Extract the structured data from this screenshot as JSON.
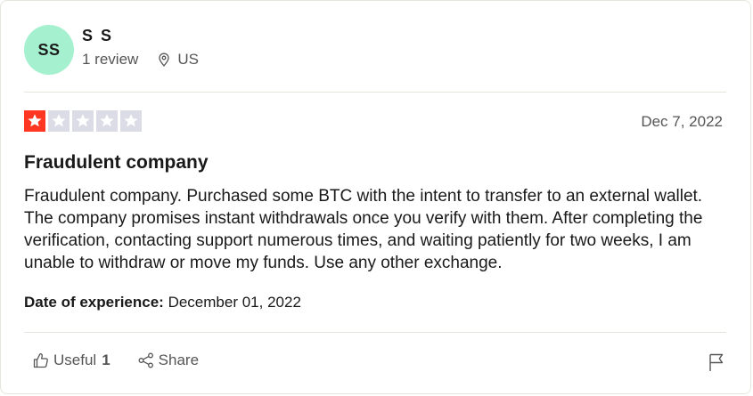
{
  "consumer": {
    "initials": "SS",
    "name": "S S",
    "review_count": "1 review",
    "country": "US",
    "avatar_color": "#a4f0cf"
  },
  "review": {
    "rating": 1,
    "max_rating": 5,
    "star_color_active": "#ff3722",
    "star_color_inactive": "#dcdce6",
    "date": "Dec 7, 2022",
    "title": "Fraudulent company",
    "body": "Fraudulent company. Purchased some BTC with the intent to transfer to an external wallet. The company promises instant withdrawals once you verify with them. After completing the verification, contacting support numerous times, and waiting patiently for two weeks, I am unable to withdraw or move my funds. Use any other exchange.",
    "experience_label": "Date of experience:",
    "experience_date": "December 01, 2022"
  },
  "actions": {
    "useful_label": "Useful",
    "useful_count": "1",
    "share_label": "Share",
    "icons": [
      "thumbs-up-icon",
      "share-icon",
      "flag-icon",
      "location-pin-icon",
      "star-icon"
    ]
  }
}
